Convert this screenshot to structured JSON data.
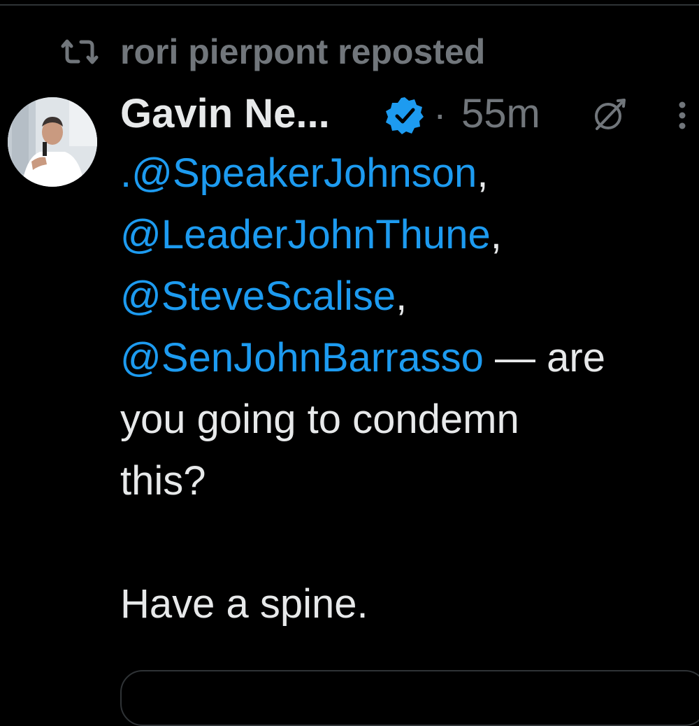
{
  "repost": {
    "label": "rori pierpont reposted",
    "icon": "repost-icon"
  },
  "tweet": {
    "display_name": "Gavin Ne...",
    "verified_icon": "verified-badge-icon",
    "separator": "·",
    "timestamp": "55m",
    "grok_icon": "grok-icon",
    "more_icon": "more-icon",
    "mentions": [
      ".@SpeakerJohnson",
      "@LeaderJohnThune",
      "@SteveScalise",
      "@SenJohnBarrasso"
    ],
    "comma": ",",
    "dash_text": " — are",
    "line_5": "you going to condemn",
    "line_6": "this?",
    "line_7": "Have a spine."
  },
  "colors": {
    "background": "#000000",
    "text": "#e7e9ea",
    "muted": "#71767b",
    "link": "#1d9bf0",
    "verified": "#1d9bf0"
  }
}
